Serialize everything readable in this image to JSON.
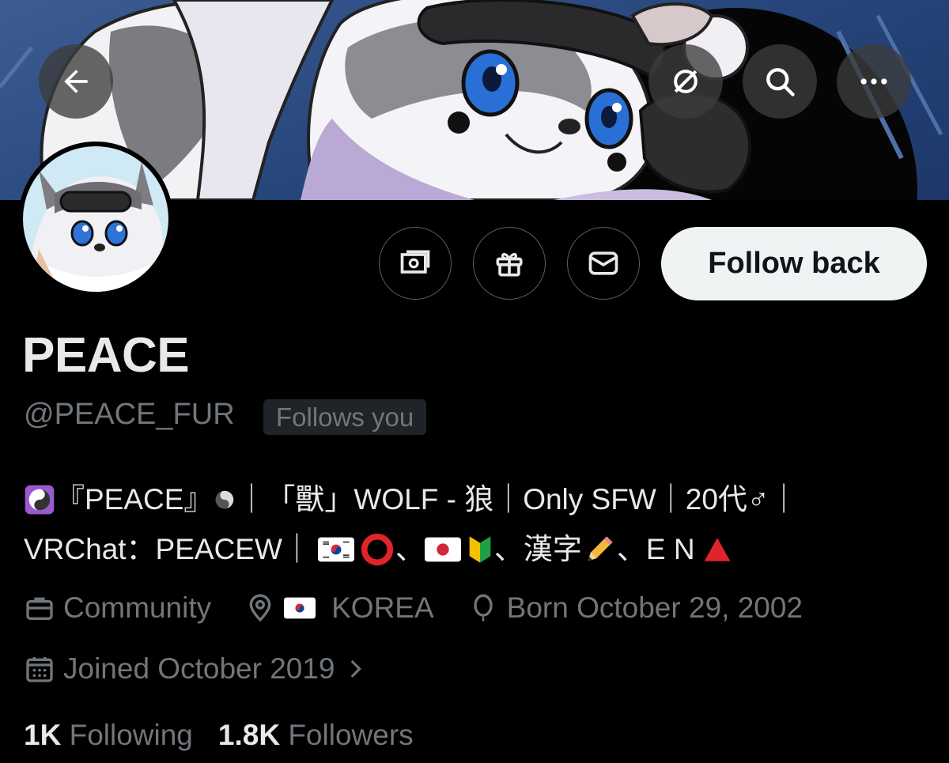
{
  "header": {
    "back_icon": "arrow-left-icon",
    "grok_icon": "grok-icon",
    "search_icon": "search-icon",
    "more_icon": "more-horizontal-icon"
  },
  "actions": {
    "subscribe_icon": "money-icon",
    "gift_icon": "gift-icon",
    "message_icon": "envelope-icon",
    "follow_label": "Follow back"
  },
  "profile": {
    "name": "PEACE",
    "handle": "@PEACE_FUR",
    "follows_you": "Follows you",
    "bio_line1_a": "『PEACE』",
    "bio_line1_b": "｜「獸」WOLF - 狼｜Only SFW｜20代♂｜",
    "bio_line2_a": "VRChat：PEACEW｜",
    "bio_line2_b": "、",
    "bio_line2_c": "、漢字",
    "bio_line2_d": "、E N",
    "category": "Community",
    "location": "KOREA",
    "born": "Born October 29, 2002",
    "joined": "Joined October 2019"
  },
  "stats": {
    "following_count": "1K",
    "following_label": "Following",
    "followers_count": "1.8K",
    "followers_label": "Followers"
  },
  "colors": {
    "background": "#000000",
    "text_primary": "#e7e9ea",
    "text_secondary": "#71767b",
    "button_bg": "#eff3f4"
  }
}
